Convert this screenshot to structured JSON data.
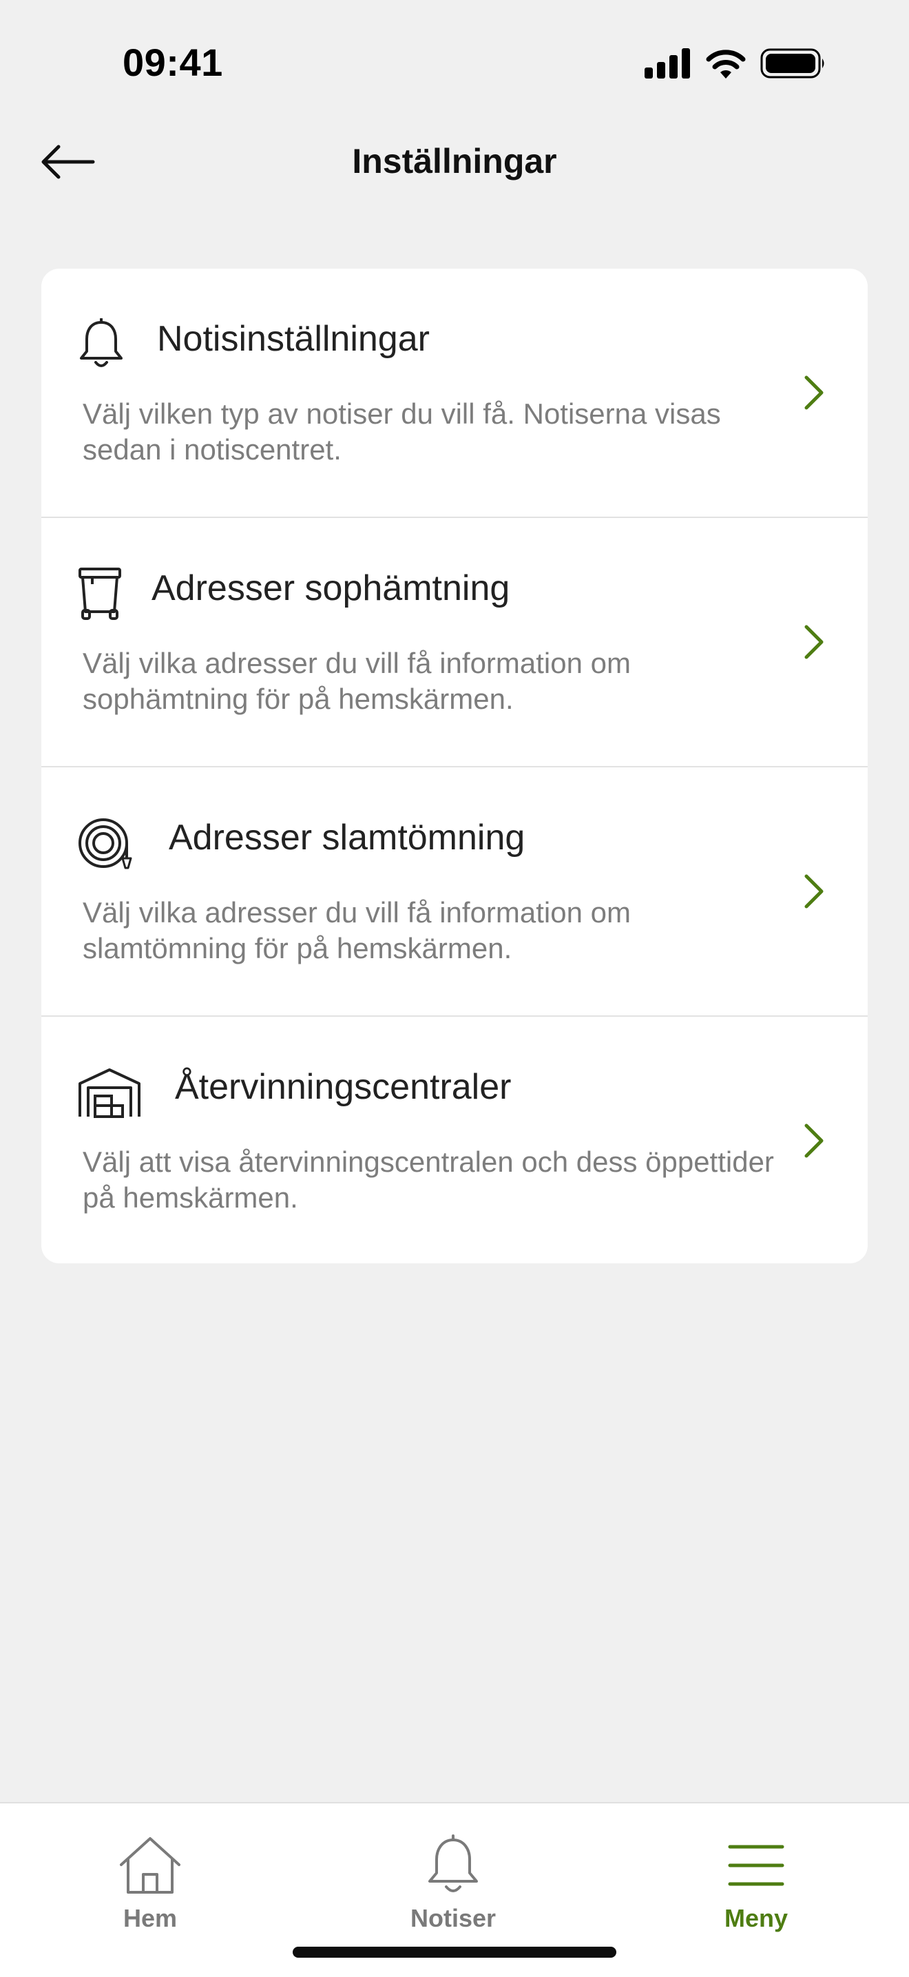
{
  "status_bar": {
    "time": "09:41"
  },
  "header": {
    "title": "Inställningar",
    "back_icon": "arrow-left-icon"
  },
  "settings": {
    "items": [
      {
        "icon": "bell-icon",
        "title": "Notisinställningar",
        "description": "Välj vilken typ av notiser du vill få. Notiserna visas sedan i notiscentret."
      },
      {
        "icon": "trash-bin-icon",
        "title": "Adresser sophämtning",
        "description": "Välj vilka adresser du vill få information om sophämtning för på hemskärmen."
      },
      {
        "icon": "hose-reel-icon",
        "title": "Adresser slamtömning",
        "description": "Välj vilka adresser du vill få information om slamtömning för på hemskärmen."
      },
      {
        "icon": "recycling-center-icon",
        "title": "Återvinningscentraler",
        "description": "Välj att visa återvinningscentralen och dess öppettider på hemskärmen."
      }
    ]
  },
  "bottom_nav": {
    "items": [
      {
        "label": "Hem",
        "icon": "home-icon",
        "active": false
      },
      {
        "label": "Notiser",
        "icon": "bell-icon",
        "active": false
      },
      {
        "label": "Meny",
        "icon": "menu-icon",
        "active": true
      }
    ]
  },
  "colors": {
    "accent": "#4e7d12",
    "background": "#f0f0f0",
    "card": "#ffffff",
    "muted_text": "#7d7d7d",
    "inactive_nav": "#7a7a7a"
  }
}
